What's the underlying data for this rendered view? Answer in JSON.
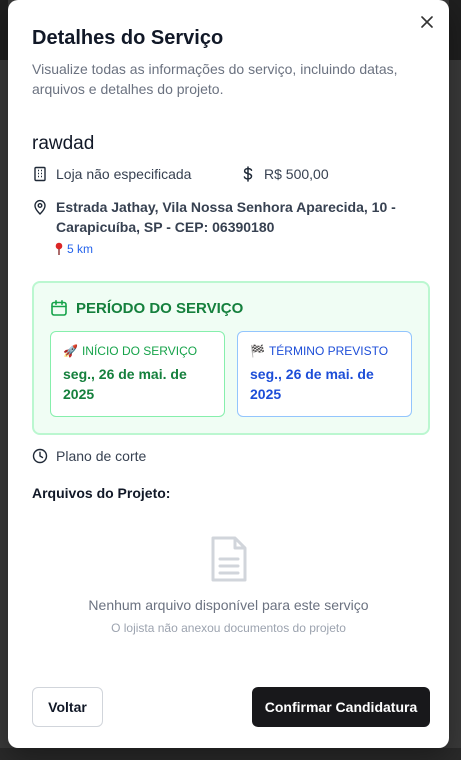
{
  "modal": {
    "title": "Detalhes do Serviço",
    "subtitle": "Visualize todas as informações do serviço, incluindo datas, arquivos e detalhes do projeto.",
    "close_icon": "close-icon"
  },
  "service": {
    "name": "rawdad",
    "store": "Loja não especificada",
    "price": "R$ 500,00",
    "address": "Estrada Jathay, Vila Nossa Senhora Aparecida, 10 - Carapicuíba, SP - CEP: 06390180",
    "distance": "5 km"
  },
  "period": {
    "title": "PERÍODO DO SERVIÇO",
    "start_label": "INÍCIO DO SERVIÇO",
    "start_date": "seg., 26 de mai. de 2025",
    "end_label": "TÉRMINO PREVISTO",
    "end_date": "seg., 26 de mai. de 2025",
    "start_emoji": "🚀",
    "end_emoji": "🏁"
  },
  "plan": "Plano de corte",
  "files": {
    "title": "Arquivos do Projeto:",
    "empty_title": "Nenhum arquivo disponível para este serviço",
    "empty_subtitle": "O lojista não anexou documentos do projeto"
  },
  "footer": {
    "back_label": "Voltar",
    "confirm_label": "Confirmar Candidatura"
  },
  "colors": {
    "period_bg": "#f0fdf4",
    "period_green": "#15803d",
    "end_blue": "#1d4ed8",
    "primary_button": "#18181b"
  }
}
